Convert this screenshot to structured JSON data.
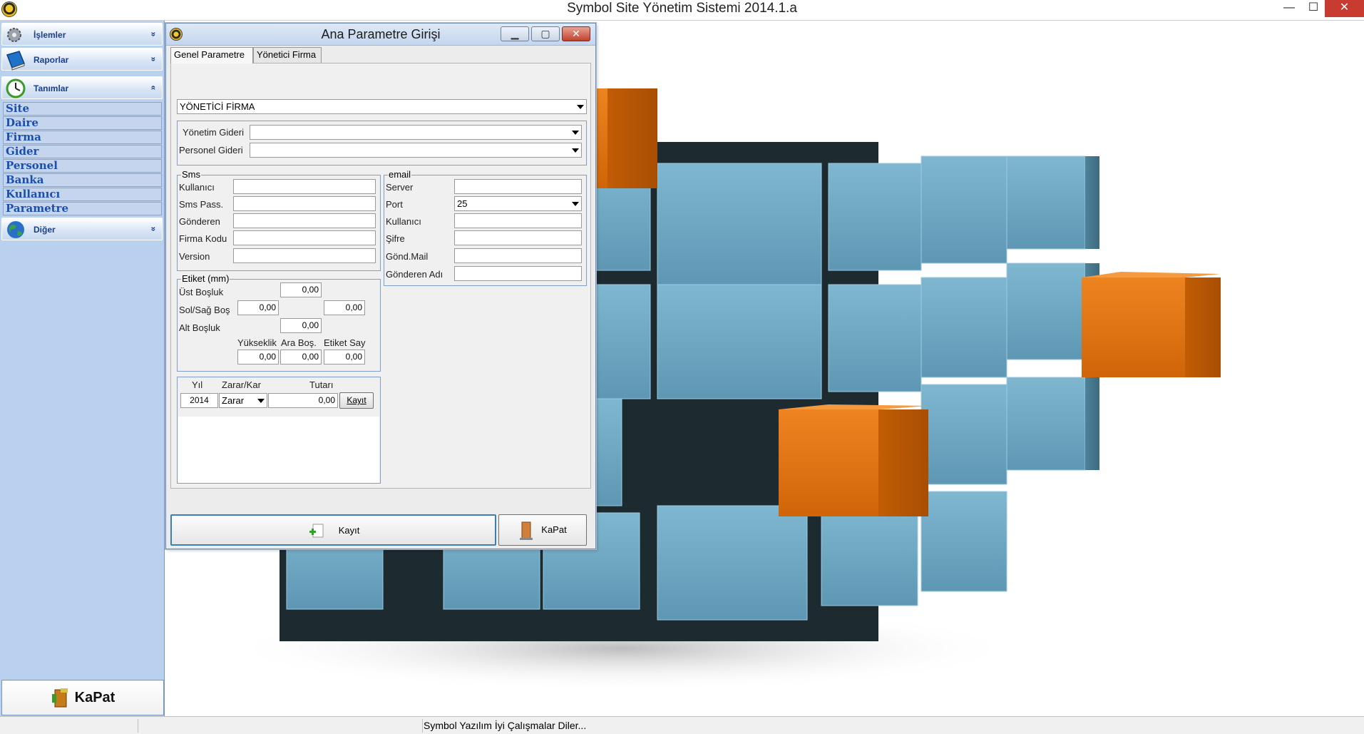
{
  "window": {
    "title": "Symbol Site Yönetim Sistemi 2014.1.a",
    "minimize": "—",
    "maximize": "☐",
    "close": "✕"
  },
  "sidebar": {
    "groups": [
      {
        "label": "İşlemler",
        "chevron": "»"
      },
      {
        "label": "Raporlar",
        "chevron": "»"
      },
      {
        "label": "Tanımlar",
        "chevron": "«"
      },
      {
        "label": "Diğer",
        "chevron": "»"
      }
    ],
    "items": [
      "Site",
      "Daire",
      "Firma",
      "Gider",
      "Personel",
      "Banka",
      "Kullanıcı",
      "Parametre"
    ],
    "close_button": "KaPat"
  },
  "statusbar": {
    "message": "Symbol Yazılım İyi Çalışmalar Diler..."
  },
  "dialog": {
    "title": "Ana Parametre Girişi",
    "tabs": [
      "Genel Parametre",
      "Yönetici Firma"
    ],
    "firma_combo": "YÖNETİCİ FİRMA",
    "yonetim_gideri_label": "Yönetim Gideri",
    "yonetim_gideri_value": "",
    "personel_gideri_label": "Personel Gideri",
    "personel_gideri_value": "",
    "sms": {
      "title": "Sms",
      "fields": [
        {
          "label": "Kullanıcı",
          "value": ""
        },
        {
          "label": "Sms Pass.",
          "value": ""
        },
        {
          "label": "Gönderen",
          "value": ""
        },
        {
          "label": "Firma Kodu",
          "value": ""
        },
        {
          "label": "Version",
          "value": ""
        }
      ]
    },
    "email": {
      "title": "email",
      "server_label": "Server",
      "server_value": "",
      "port_label": "Port",
      "port_value": "25",
      "kullanici_label": "Kullanıcı",
      "kullanici_value": "",
      "sifre_label": "Şifre",
      "sifre_value": "",
      "gond_mail_label": "Gönd.Mail",
      "gond_mail_value": "",
      "gonderen_adi_label": "Gönderen Adı",
      "gonderen_adi_value": ""
    },
    "etiket": {
      "title": "Etiket (mm)",
      "ust_label": "Üst Boşluk",
      "ust_value": "0,00",
      "solsag_label": "Sol/Sağ Boş",
      "sol_value": "0,00",
      "sag_value": "0,00",
      "alt_label": "Alt Boşluk",
      "alt_value": "0,00",
      "yukseklik_label": "Yükseklik",
      "yukseklik_value": "0,00",
      "arabos_label": "Ara Boş.",
      "arabos_value": "0,00",
      "etiketsay_label": "Etiket Say",
      "etiketsay_value": "0,00"
    },
    "zarar": {
      "yil_label": "Yıl",
      "zararkar_label": "Zarar/Kar",
      "tutari_label": "Tutarı",
      "yil_value": "2014",
      "zararkar_value": "Zarar",
      "tutari_value": "0,00",
      "kayit_button": "Kayıt"
    },
    "save_button": "Kayıt",
    "close_button": "KaPat"
  },
  "colors": {
    "sidebar_bg": "#b9d1ee",
    "nav_text": "#1a4fb0",
    "cube_blue": "#6fa9c4",
    "cube_orange": "#e6760f",
    "close_red": "#c73b31"
  }
}
